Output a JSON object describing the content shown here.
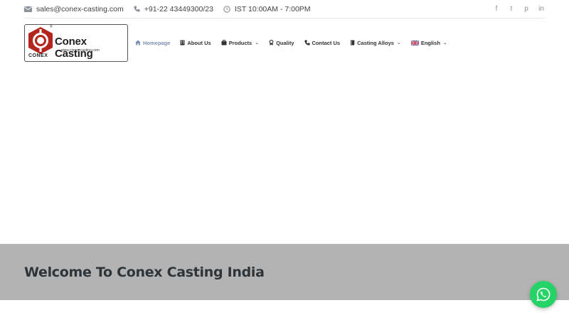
{
  "topbar": {
    "email": "sales@conex-casting.com",
    "phone": "+91-22 43449300/23",
    "hours": "IST 10:00AM - 7:00PM",
    "social": [
      "f",
      "t",
      "p",
      "in"
    ]
  },
  "logo": {
    "brand": "Conex Casting",
    "url": "www.conex-casting.com",
    "mark_text": "CONEX",
    "reg": "®"
  },
  "nav": {
    "items": [
      {
        "label": "Homepage",
        "icon": "home-icon",
        "active": true,
        "dropdown": false
      },
      {
        "label": "About Us",
        "icon": "building-icon",
        "active": false,
        "dropdown": false
      },
      {
        "label": "Products",
        "icon": "products-icon",
        "active": false,
        "dropdown": true
      },
      {
        "label": "Quality",
        "icon": "award-icon",
        "active": false,
        "dropdown": false
      },
      {
        "label": "Contact Us",
        "icon": "phone-icon",
        "active": false,
        "dropdown": false
      },
      {
        "label": "Casting Alloys",
        "icon": "book-icon",
        "active": false,
        "dropdown": true
      },
      {
        "label": "English",
        "icon": "uk-flag-icon",
        "active": false,
        "dropdown": true
      }
    ],
    "chevron": "⌄"
  },
  "welcome": {
    "title": "Welcome To Conex Casting India"
  },
  "colors": {
    "accent": "#7b8fb3",
    "welcome_bg": "#b3b3b3",
    "whatsapp": "#25d366",
    "logo_red": "#b3261e"
  }
}
